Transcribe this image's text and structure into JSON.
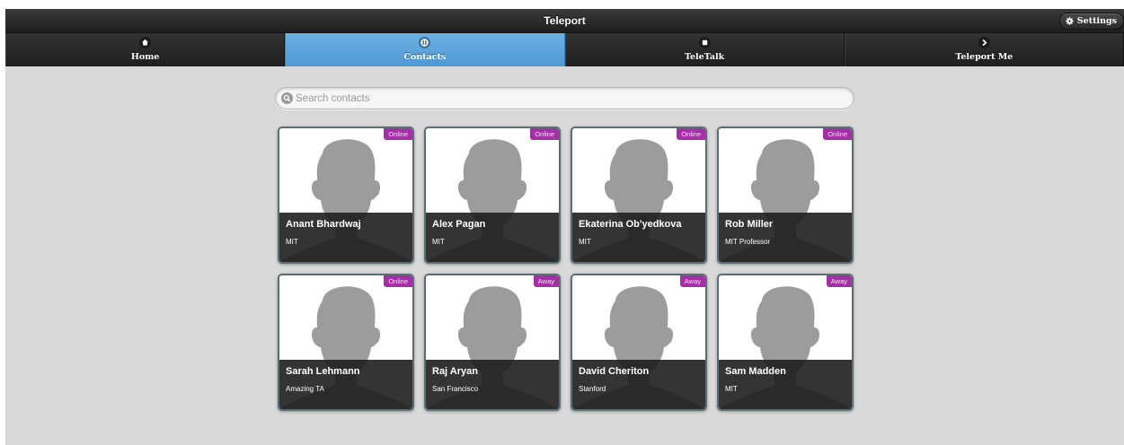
{
  "window": {
    "title": "Teleport"
  },
  "header": {
    "settings_label": "Settings",
    "settings_icon": "gear-icon"
  },
  "nav": {
    "items": [
      {
        "label": "Home",
        "icon": "home-icon",
        "active": false
      },
      {
        "label": "Contacts",
        "icon": "grid-icon",
        "active": true
      },
      {
        "label": "TeleTalk",
        "icon": "square-icon",
        "active": false
      },
      {
        "label": "Teleport Me",
        "icon": "chevron-right-icon",
        "active": false
      }
    ]
  },
  "search": {
    "placeholder": "Search contacts",
    "value": ""
  },
  "contacts": [
    {
      "name": "Anant Bhardwaj",
      "subtitle": "MIT",
      "status": "Online"
    },
    {
      "name": "Alex Pagan",
      "subtitle": "MIT",
      "status": "Online"
    },
    {
      "name": "Ekaterina Ob'yedkova",
      "subtitle": "MIT",
      "status": "Online"
    },
    {
      "name": "Rob Miller",
      "subtitle": "MIT Professor",
      "status": "Online"
    },
    {
      "name": "Sarah Lehmann",
      "subtitle": "Amazing TA",
      "status": "Online"
    },
    {
      "name": "Raj Aryan",
      "subtitle": "San Francisco",
      "status": "Away"
    },
    {
      "name": "David Cheriton",
      "subtitle": "Stanford",
      "status": "Away"
    },
    {
      "name": "Sam Madden",
      "subtitle": "MIT",
      "status": "Away"
    }
  ],
  "colors": {
    "accent": "#5aa3dc",
    "status_badge": "#a52fa7",
    "bar": "#262626",
    "background": "#d9d9d9"
  }
}
